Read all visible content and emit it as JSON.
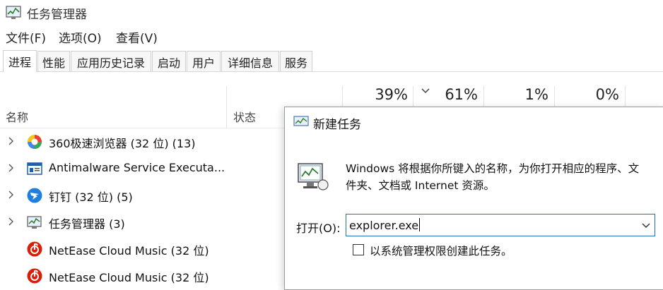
{
  "window": {
    "title": "任务管理器"
  },
  "menu": [
    "文件(F)",
    "选项(O)",
    "查看(V)"
  ],
  "tabs": [
    "进程",
    "性能",
    "应用历史记录",
    "启动",
    "用户",
    "详细信息",
    "服务"
  ],
  "active_tab": 0,
  "usage": {
    "cpu": "39%",
    "memory": "61%",
    "disk": "1%",
    "network": "0%"
  },
  "columns": {
    "name": "名称",
    "status": "状态"
  },
  "processes": [
    {
      "name": "360极速浏览器 (32 位) (13)",
      "icon": "browser-360-icon",
      "expandable": true
    },
    {
      "name": "Antimalware Service Executa...",
      "icon": "antimalware-icon",
      "expandable": true
    },
    {
      "name": "钉钉 (32 位) (5)",
      "icon": "dingtalk-icon",
      "expandable": true
    },
    {
      "name": "任务管理器 (3)",
      "icon": "task-manager-icon",
      "expandable": true
    },
    {
      "name": "NetEase Cloud Music (32 位)",
      "icon": "netease-music-icon",
      "expandable": false
    },
    {
      "name": "NetEase Cloud Music (32 位)",
      "icon": "netease-music-icon",
      "expandable": false
    }
  ],
  "dialog": {
    "title": "新建任务",
    "description": "Windows 将根据你所键入的名称，为你打开相应的程序、文件夹、文档或 Internet 资源。",
    "open_label": "打开(O):",
    "open_value": "explorer.exe",
    "admin_label": "以系统管理权限创建此任务。",
    "admin_checked": false
  },
  "colors": {
    "accent": "#1f6fc4",
    "netease": "#d81e06",
    "dingtalk": "#1e7fe0"
  }
}
